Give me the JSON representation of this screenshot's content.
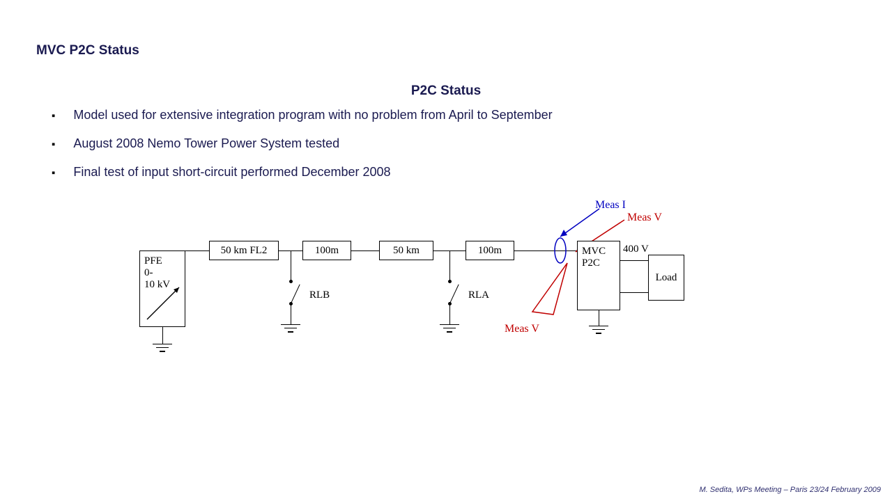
{
  "header": {
    "title": "MVC  P2C Status"
  },
  "subtitle": "P2C Status",
  "bullets": [
    "Model used for extensive integration program with no problem from April to September",
    "August 2008 Nemo Tower Power System tested",
    "Final test of input short-circuit performed December 2008"
  ],
  "diagram": {
    "pfe_top": "PFE",
    "pfe_mid": "0-",
    "pfe_bot": "10 kV",
    "seg1": "50 km FL2",
    "seg2": "100m",
    "seg3": "50 km",
    "seg4": "100m",
    "rla": "RLA",
    "rlb": "RLB",
    "mvc_top": "MVC",
    "mvc_bot": "P2C",
    "load": "Load",
    "v400": "400 V",
    "meas_i": "Meas I",
    "meas_v1": "Meas V",
    "meas_v2": "Meas V"
  },
  "footer": "M. Sedita, WPs Meeting – Paris 23/24 February 2009"
}
